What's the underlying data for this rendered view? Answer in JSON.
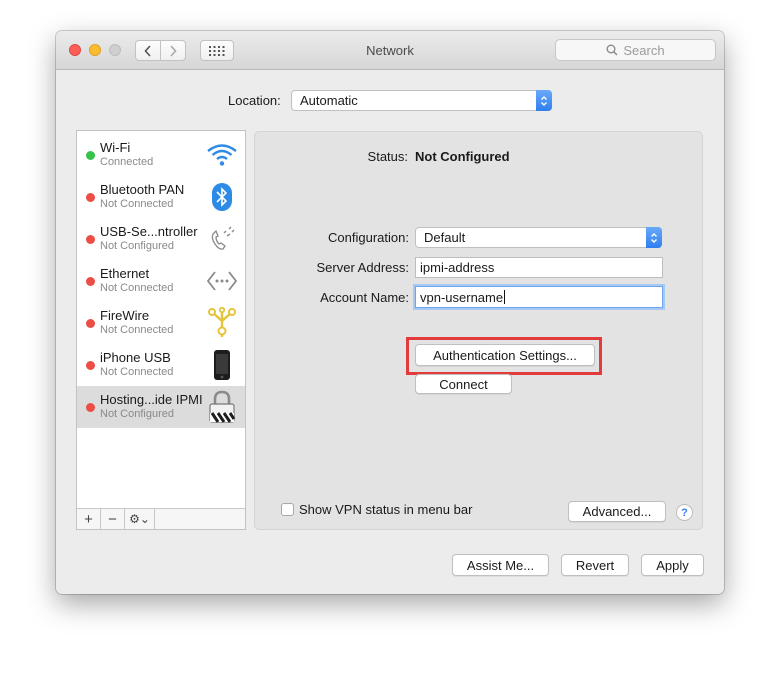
{
  "window": {
    "title": "Network"
  },
  "toolbar": {
    "search_placeholder": "Search"
  },
  "location": {
    "label": "Location:",
    "value": "Automatic"
  },
  "services": [
    {
      "name": "Wi-Fi",
      "status": "Connected",
      "status_color": "#35c249",
      "icon": "wifi-icon"
    },
    {
      "name": "Bluetooth PAN",
      "status": "Not Connected",
      "status_color": "#ec4d45",
      "icon": "bluetooth-icon"
    },
    {
      "name": "USB-Se...ntroller",
      "status": "Not Configured",
      "status_color": "#ec4d45",
      "icon": "phone-icon"
    },
    {
      "name": "Ethernet",
      "status": "Not Connected",
      "status_color": "#ec4d45",
      "icon": "ethernet-icon"
    },
    {
      "name": "FireWire",
      "status": "Not Connected",
      "status_color": "#ec4d45",
      "icon": "firewire-icon"
    },
    {
      "name": "iPhone USB",
      "status": "Not Connected",
      "status_color": "#ec4d45",
      "icon": "iphone-icon"
    },
    {
      "name": "Hosting...ide IPMI",
      "status": "Not Configured",
      "status_color": "#ec4d45",
      "icon": "vpn-lock-icon",
      "selected": true
    }
  ],
  "sidebar_controls": {
    "add": "+",
    "remove": "−",
    "gear": "⚙⌄"
  },
  "detail": {
    "status_label": "Status:",
    "status_value": "Not Configured",
    "configuration_label": "Configuration:",
    "configuration_value": "Default",
    "server_label": "Server Address:",
    "server_value": "ipmi-address",
    "account_label": "Account Name:",
    "account_value": "vpn-username",
    "auth_button": "Authentication Settings...",
    "connect_button": "Connect",
    "show_vpn_label": "Show VPN status in menu bar",
    "show_vpn_checked": false,
    "advanced_button": "Advanced...",
    "help": "?"
  },
  "footer": {
    "assist": "Assist Me...",
    "revert": "Revert",
    "apply": "Apply"
  },
  "colors": {
    "accent": "#2f7ef0",
    "highlight_box": "#e23b3b"
  }
}
